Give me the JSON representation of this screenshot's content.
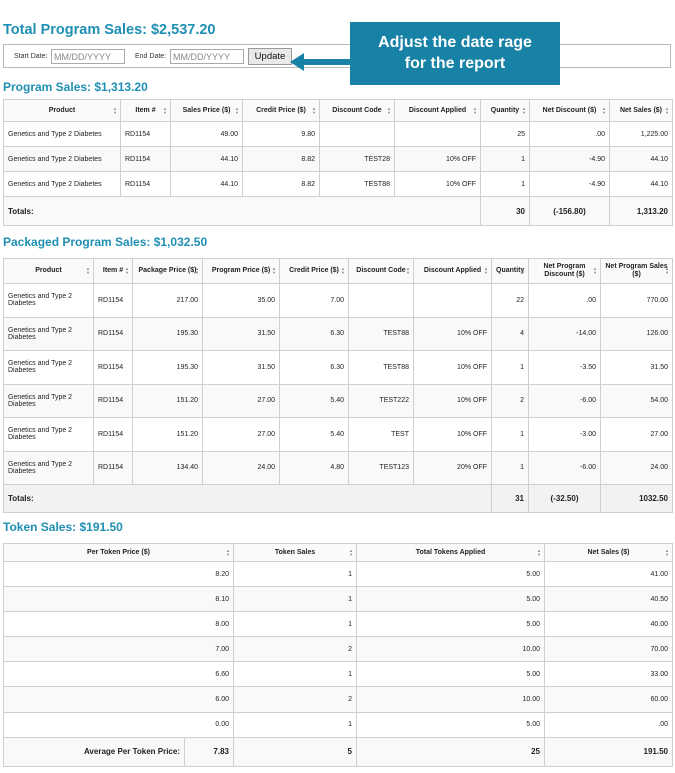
{
  "total_title": "Total Program Sales: $2,537.20",
  "date_filter": {
    "start_label": "Start Date:",
    "start_placeholder": "MM/DD/YYYY",
    "end_label": "End Date:",
    "end_placeholder": "MM/DD/YYYY",
    "update_label": "Update"
  },
  "callout": {
    "line1": "Adjust the date rage",
    "line2": "for the report"
  },
  "program_sales": {
    "title": "Program Sales: $1,313.20",
    "headers": [
      "Product",
      "Item #",
      "Sales Price ($)",
      "Credit Price ($)",
      "Discount Code",
      "Discount Applied",
      "Quantity",
      "Net Discount ($)",
      "Net Sales ($)"
    ],
    "rows": [
      [
        "Genetics and Type 2 Diabetes",
        "RD1154",
        "49.00",
        "9.80",
        "",
        "",
        "25",
        ".00",
        "1,225.00"
      ],
      [
        "Genetics and Type 2 Diabetes",
        "RD1154",
        "44.10",
        "8.82",
        "TEST28",
        "10% OFF",
        "1",
        "-4.90",
        "44.10"
      ],
      [
        "Genetics and Type 2 Diabetes",
        "RD1154",
        "44.10",
        "8.82",
        "TEST88",
        "10% OFF",
        "1",
        "-4.90",
        "44.10"
      ]
    ],
    "totals": {
      "label": "Totals:",
      "quantity": "30",
      "net_discount": "(-156.80)",
      "net_sales": "1,313.20"
    }
  },
  "packaged_sales": {
    "title": "Packaged Program Sales: $1,032.50",
    "headers": [
      "Product",
      "Item #",
      "Package Price ($)",
      "Program Price ($)",
      "Credit Price ($)",
      "Discount Code",
      "Discount Applied",
      "Quantity",
      "Net Program Discount ($)",
      "Net Program Sales ($)"
    ],
    "rows": [
      [
        "Genetics and Type 2 Diabetes",
        "RD1154",
        "217.00",
        "35.00",
        "7.00",
        "",
        "",
        "22",
        ".00",
        "770.00"
      ],
      [
        "Genetics and Type 2 Diabetes",
        "RD1154",
        "195.30",
        "31.50",
        "6.30",
        "TEST88",
        "10% OFF",
        "4",
        "-14.00",
        "126.00"
      ],
      [
        "Genetics and Type 2 Diabetes",
        "RD1154",
        "195.30",
        "31.50",
        "6.30",
        "TEST88",
        "10% OFF",
        "1",
        "-3.50",
        "31.50"
      ],
      [
        "Genetics and Type 2 Diabetes",
        "RD1154",
        "151.20",
        "27.00",
        "5.40",
        "TEST222",
        "10% OFF",
        "2",
        "-6.00",
        "54.00"
      ],
      [
        "Genetics and Type 2 Diabetes",
        "RD1154",
        "151.20",
        "27.00",
        "5.40",
        "TEST",
        "10% OFF",
        "1",
        "-3.00",
        "27.00"
      ],
      [
        "Genetics and Type 2 Diabetes",
        "RD1154",
        "134.40",
        "24.00",
        "4.80",
        "TEST123",
        "20% OFF",
        "1",
        "-6.00",
        "24.00"
      ]
    ],
    "totals": {
      "label": "Totals:",
      "quantity": "31",
      "net_discount": "(-32.50)",
      "net_sales": "1032.50"
    }
  },
  "token_sales": {
    "title": "Token Sales: $191.50",
    "headers": [
      "Per Token Price ($)",
      "Token Sales",
      "Total Tokens Applied",
      "Net Sales ($)"
    ],
    "rows": [
      [
        "8.20",
        "1",
        "5.00",
        "41.00"
      ],
      [
        "8.10",
        "1",
        "5.00",
        "40.50"
      ],
      [
        "8.00",
        "1",
        "5.00",
        "40.00"
      ],
      [
        "7.00",
        "2",
        "10.00",
        "70.00"
      ],
      [
        "6.60",
        "1",
        "5.00",
        "33.00"
      ],
      [
        "6.00",
        "2",
        "10.00",
        "60.00"
      ],
      [
        "0.00",
        "1",
        "5.00",
        ".00"
      ]
    ],
    "totals": {
      "label": "Average Per Token Price:",
      "avg": "7.83",
      "token_sales": "5",
      "tokens_applied": "25",
      "net_sales": "191.50"
    }
  },
  "colors": {
    "heading": "#1f8fb3",
    "callout": "#1782a6"
  }
}
